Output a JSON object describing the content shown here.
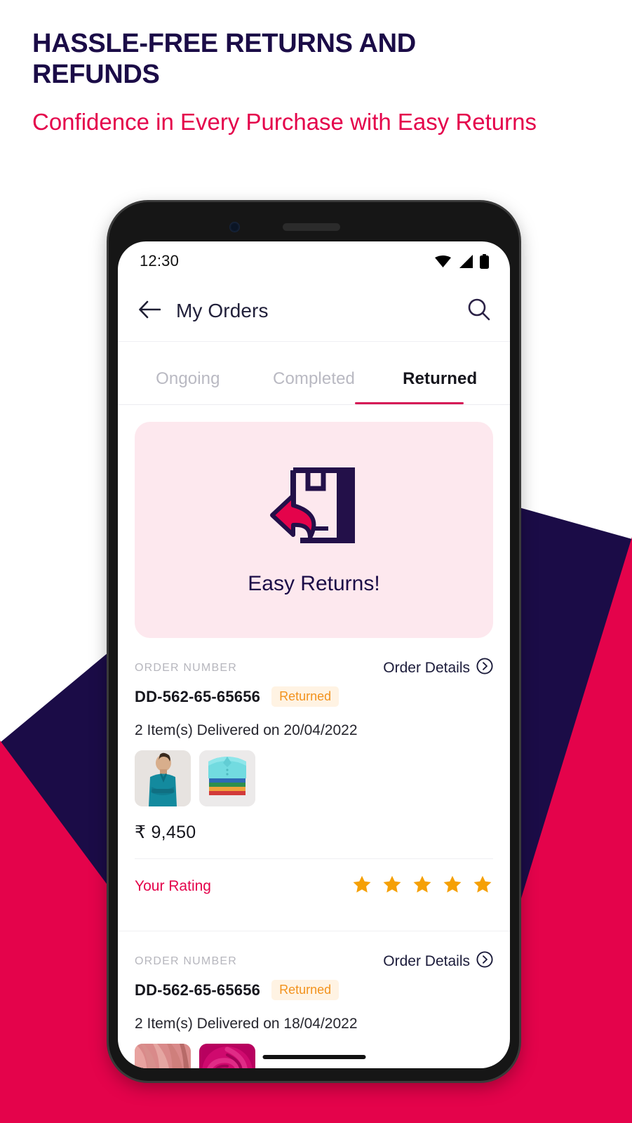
{
  "theme": {
    "navy": "#1B0C47",
    "crimson": "#E4034B",
    "pink_card": "#FDE8EE",
    "badge_orange": "#F2921D",
    "badge_bg": "#FFF3E3",
    "star_orange": "#F5A006",
    "tab_active_underline": "#D61A56"
  },
  "promo_heading": {
    "title": "HASSLE-FREE RETURNS AND REFUNDS",
    "subtitle": "Confidence in Every Purchase with Easy Returns"
  },
  "phone": {
    "status_bar": {
      "time": "12:30",
      "icons": [
        "wifi-icon",
        "signal-icon",
        "battery-icon"
      ]
    },
    "app_bar": {
      "back_icon": "arrow-left-icon",
      "title": "My Orders",
      "search_icon": "search-icon"
    },
    "tabs": [
      {
        "label": "Ongoing",
        "active": false
      },
      {
        "label": "Completed",
        "active": false
      },
      {
        "label": "Returned",
        "active": true
      }
    ],
    "promo_card": {
      "icon": "return-box-icon",
      "label": "Easy Returns!"
    },
    "orders": [
      {
        "order_number_label": "ORDER NUMBER",
        "details_link": "Order Details",
        "details_icon": "chevron-right-circle-icon",
        "order_id": "DD-562-65-65656",
        "status_badge": "Returned",
        "meta": "2 Item(s) Delivered on 20/04/2022",
        "thumbnails": [
          "man-in-teal-kurta-photo",
          "folded-shirts-stack-photo"
        ],
        "price": "₹ 9,450",
        "rating_label": "Your Rating",
        "rating_value": 5,
        "rating_max": 5
      },
      {
        "order_number_label": "ORDER NUMBER",
        "details_link": "Order Details",
        "details_icon": "chevron-right-circle-icon",
        "order_id": "DD-562-65-65656",
        "status_badge": "Returned",
        "meta": "2 Item(s) Delivered on 18/04/2022",
        "thumbnails": [
          "pink-draped-fabric-photo",
          "magenta-swirl-fabric-photo"
        ],
        "price": "",
        "rating_label": "",
        "rating_value": 0,
        "rating_max": 5
      }
    ]
  }
}
